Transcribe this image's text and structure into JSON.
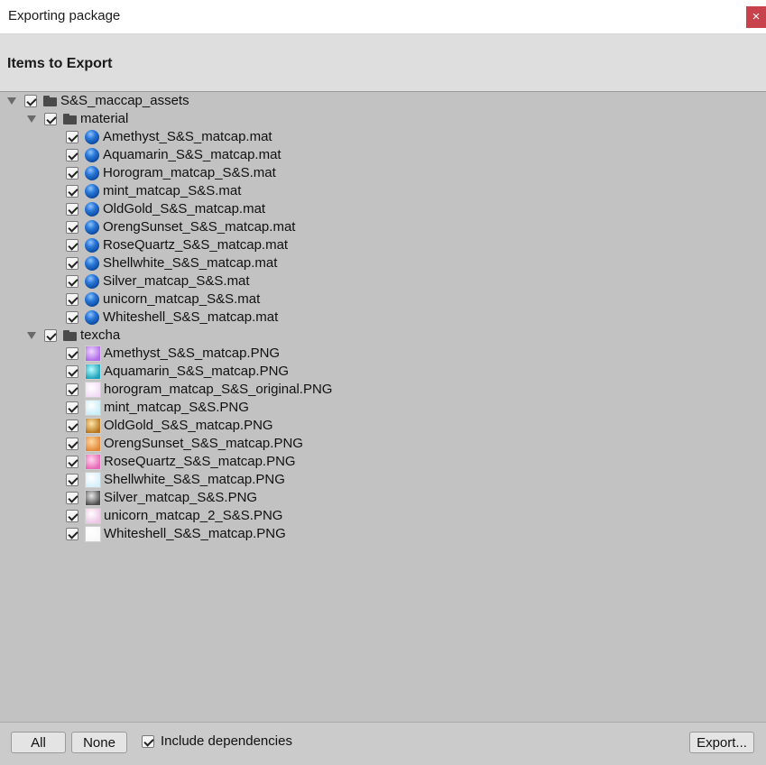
{
  "window": {
    "title": "Exporting package",
    "close_glyph": "×"
  },
  "header": {
    "title": "Items to Export"
  },
  "tree": {
    "root": {
      "label": "S&S_maccap_assets",
      "checked": true
    },
    "groups": [
      {
        "label": "material",
        "checked": true,
        "items": [
          {
            "label": "Amethyst_S&S_matcap.mat",
            "icon": "material-sphere-icon"
          },
          {
            "label": "Aquamarin_S&S_matcap.mat",
            "icon": "material-sphere-icon"
          },
          {
            "label": "Horogram_matcap_S&S.mat",
            "icon": "material-sphere-icon"
          },
          {
            "label": "mint_matcap_S&S.mat",
            "icon": "material-sphere-icon"
          },
          {
            "label": "OldGold_S&S_matcap.mat",
            "icon": "material-sphere-icon"
          },
          {
            "label": "OrengSunset_S&S_matcap.mat",
            "icon": "material-sphere-icon"
          },
          {
            "label": "RoseQuartz_S&S_matcap.mat",
            "icon": "material-sphere-icon"
          },
          {
            "label": "Shellwhite_S&S_matcap.mat",
            "icon": "material-sphere-icon"
          },
          {
            "label": "Silver_matcap_S&S.mat",
            "icon": "material-sphere-icon"
          },
          {
            "label": "unicorn_matcap_S&S.mat",
            "icon": "material-sphere-icon"
          },
          {
            "label": "Whiteshell_S&S_matcap.mat",
            "icon": "material-sphere-icon"
          }
        ]
      },
      {
        "label": "texcha",
        "checked": true,
        "items": [
          {
            "label": "Amethyst_S&S_matcap.PNG",
            "icon": "texture-thumbnail-icon",
            "colors": [
              "#f0d6ff",
              "#b06be8"
            ]
          },
          {
            "label": "Aquamarin_S&S_matcap.PNG",
            "icon": "texture-thumbnail-icon",
            "colors": [
              "#b8fbff",
              "#1aa3b8"
            ]
          },
          {
            "label": "horogram_matcap_S&S_original.PNG",
            "icon": "texture-thumbnail-icon",
            "colors": [
              "#ffffff",
              "#f2dcf5"
            ]
          },
          {
            "label": "mint_matcap_S&S.PNG",
            "icon": "texture-thumbnail-icon",
            "colors": [
              "#ffffff",
              "#c9eef7"
            ]
          },
          {
            "label": "OldGold_S&S_matcap.PNG",
            "icon": "texture-thumbnail-icon",
            "colors": [
              "#ffe6a8",
              "#b8761e"
            ]
          },
          {
            "label": "OrengSunset_S&S_matcap.PNG",
            "icon": "texture-thumbnail-icon",
            "colors": [
              "#ffd9a0",
              "#e2873a"
            ]
          },
          {
            "label": "RoseQuartz_S&S_matcap.PNG",
            "icon": "texture-thumbnail-icon",
            "colors": [
              "#ffd6ef",
              "#e768b6"
            ]
          },
          {
            "label": "Shellwhite_S&S_matcap.PNG",
            "icon": "texture-thumbnail-icon",
            "colors": [
              "#ffffff",
              "#d6f0fa"
            ]
          },
          {
            "label": "Silver_matcap_S&S.PNG",
            "icon": "texture-thumbnail-icon",
            "colors": [
              "#e8e8e8",
              "#4d4d4d"
            ]
          },
          {
            "label": "unicorn_matcap_2_S&S.PNG",
            "icon": "texture-thumbnail-icon",
            "colors": [
              "#ffffff",
              "#eec6e6"
            ]
          },
          {
            "label": "Whiteshell_S&S_matcap.PNG",
            "icon": "texture-thumbnail-icon",
            "colors": [
              "#ffffff",
              "#f8f8f8"
            ]
          }
        ]
      }
    ]
  },
  "footer": {
    "all_label": "All",
    "none_label": "None",
    "include_dependencies_label": "Include dependencies",
    "include_dependencies_checked": true,
    "export_label": "Export..."
  }
}
